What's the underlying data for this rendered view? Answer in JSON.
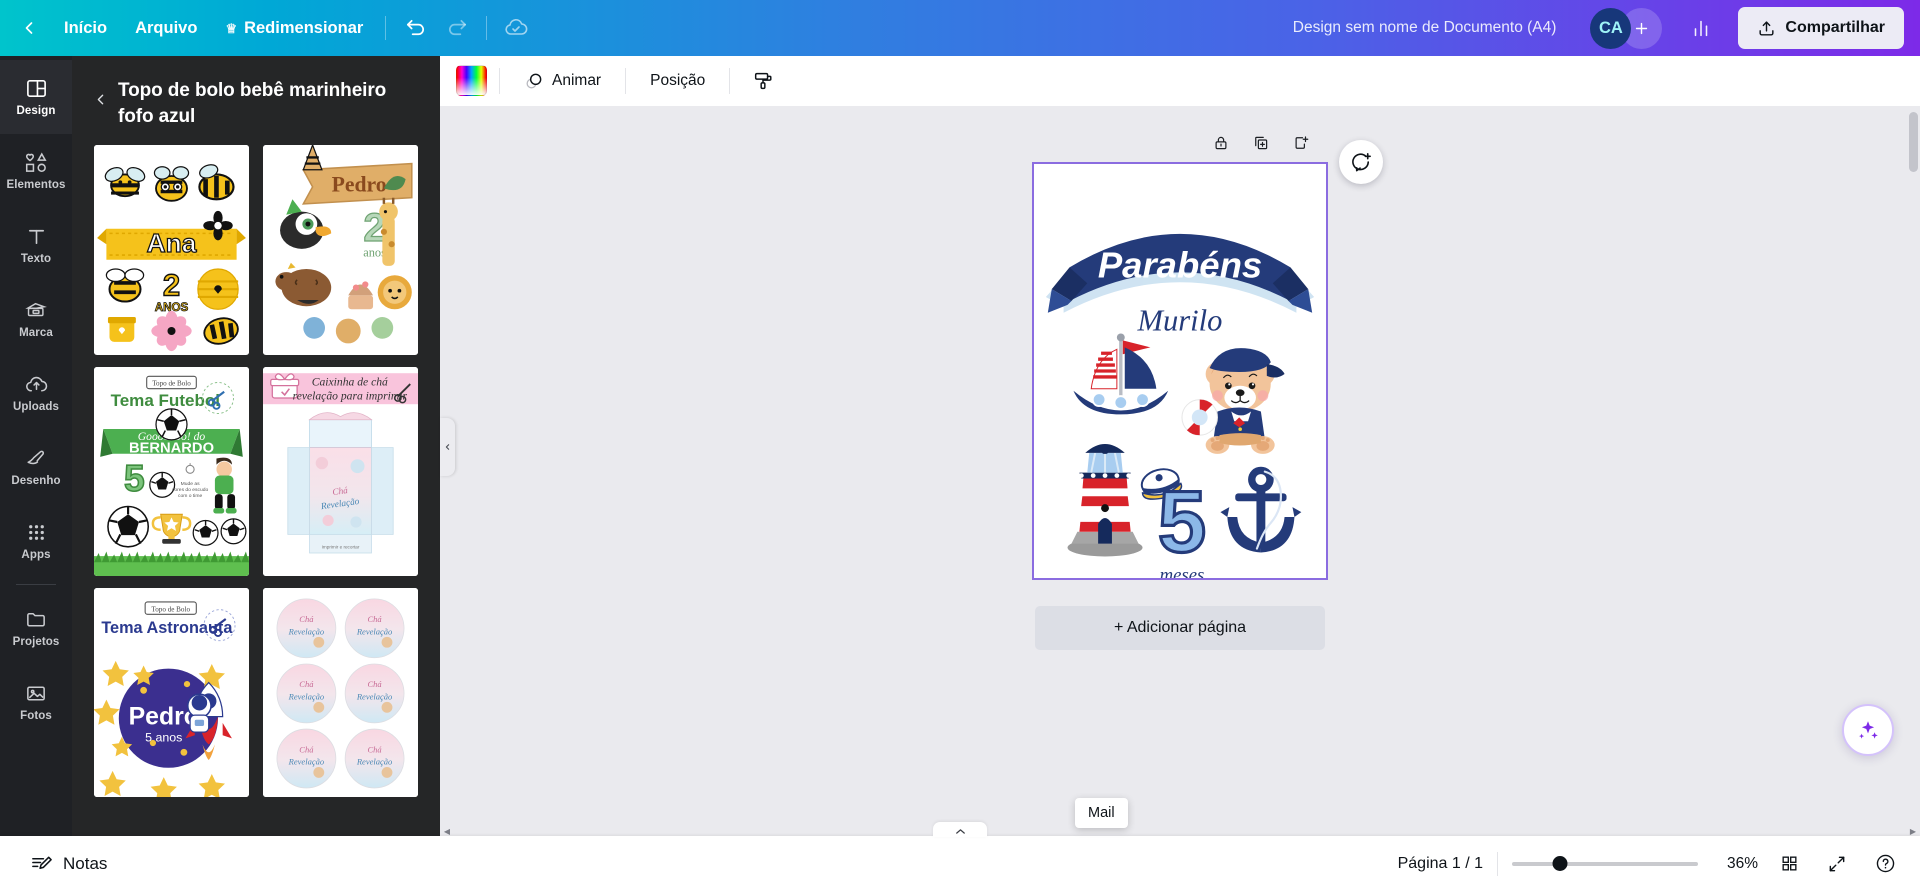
{
  "header": {
    "back_icon": "chevron-left-icon",
    "home_label": "Início",
    "file_label": "Arquivo",
    "resize_label": "Redimensionar",
    "resize_crown_icon": "crown-icon",
    "undo_icon": "undo-icon",
    "redo_icon": "redo-icon",
    "cloud_check_icon": "cloud-check-icon",
    "doc_title": "Design sem nome de Documento (A4)",
    "avatar_initials": "CA",
    "add_collaborator_icon": "plus-icon",
    "insights_icon": "bar-chart-icon",
    "share_icon": "share-upload-icon",
    "share_label": "Compartilhar",
    "accent_start": "#00c4cc",
    "accent_end": "#7d2ae8"
  },
  "rail": {
    "items": [
      {
        "label": "Design",
        "icon": "layout-icon",
        "active": true
      },
      {
        "label": "Elementos",
        "icon": "shapes-icon",
        "active": false
      },
      {
        "label": "Texto",
        "icon": "text-t-icon",
        "active": false
      },
      {
        "label": "Marca",
        "icon": "brand-card-icon",
        "active": false
      },
      {
        "label": "Uploads",
        "icon": "cloud-upload-icon",
        "active": false
      },
      {
        "label": "Desenho",
        "icon": "pen-draw-icon",
        "active": false
      },
      {
        "label": "Apps",
        "icon": "grid-apps-icon",
        "active": false
      },
      {
        "label": "Projetos",
        "icon": "folder-icon",
        "active": false
      },
      {
        "label": "Fotos",
        "icon": "photo-icon",
        "active": false
      }
    ]
  },
  "panel": {
    "back_icon": "chevron-left-icon",
    "title": "Topo de bolo bebê marinheiro fofo azul",
    "templates": [
      {
        "name": "Ana 2 anos abelhas",
        "art": "bees",
        "title_text": "Ana",
        "age_text": "2",
        "age_unit": "ANOS"
      },
      {
        "name": "Pedro 2 anos safari",
        "art": "safari",
        "title_text": "Pedro",
        "age_text": "2",
        "age_unit": "anos"
      },
      {
        "name": "Tema Futebol Bernardo",
        "art": "futebol",
        "kicker": "Topo de Bolo",
        "title_text": "Tema Futebol",
        "banner_text": "Gooooooo! do",
        "name_text": "BERNARDO",
        "age_text": "5",
        "note": "Mude as cores do escudo com o time"
      },
      {
        "name": "Caixinha de chá revelação",
        "art": "caixinha",
        "title_text": "Caixinha de chá",
        "subtitle_text": "revelação para imprimir"
      },
      {
        "name": "Tema Astronauta Pedro",
        "art": "astronauta",
        "kicker": "Topo de Bolo",
        "title_text": "Tema Astronauta",
        "name_text": "Pedro",
        "age_text": "5 anos"
      },
      {
        "name": "Tags chá revelação",
        "art": "tags",
        "tag_text": "Chá Revelação"
      }
    ]
  },
  "toolbar": {
    "color_swatch": "rainbow-color-swatch",
    "animate_icon": "animate-circles-icon",
    "animate_label": "Animar",
    "position_label": "Posição",
    "paint_roller_icon": "paint-roller-icon"
  },
  "canvas": {
    "page_tools": [
      {
        "icon": "lock-icon",
        "name": "lock-page-button"
      },
      {
        "icon": "duplicate-icon",
        "name": "duplicate-page-button"
      },
      {
        "icon": "add-page-icon",
        "name": "insert-page-button"
      }
    ],
    "comment_icon": "comment-add-icon",
    "add_page_label": "+ Adicionar página",
    "ai_icon": "magic-sparkle-icon",
    "design": {
      "banner_text": "Parabéns",
      "name_text": "Murilo",
      "age_number": "5",
      "age_unit": "meses",
      "elements": [
        "sailboat",
        "teddy-sailor-bear",
        "lighthouse",
        "number-five-cap",
        "anchor"
      ],
      "colors": {
        "navy": "#243b7a",
        "light_blue": "#a8cdf0",
        "red": "#d8232a",
        "tan": "#f2c49b"
      }
    }
  },
  "bottombar": {
    "notes_icon": "notes-icon",
    "notes_label": "Notas",
    "mail_tooltip": "Mail",
    "expand_icon": "chevron-up-icon",
    "page_count": "Página 1 / 1",
    "zoom_value": "36%",
    "zoom_percent": 36,
    "grid_view_icon": "grid-view-icon",
    "fullscreen_icon": "fullscreen-icon",
    "help_icon": "help-circle-icon"
  }
}
